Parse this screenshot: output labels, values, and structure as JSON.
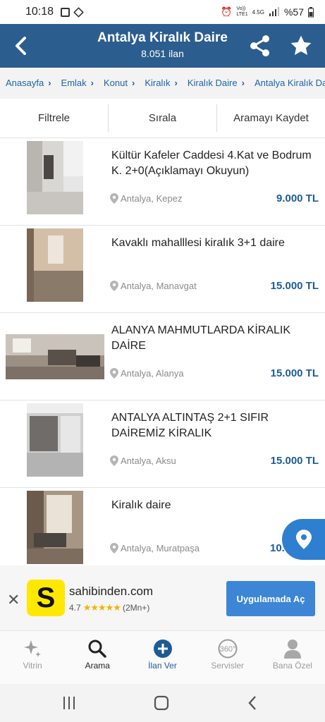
{
  "status": {
    "time": "10:18",
    "battery": "%57",
    "net_top": "Vo))",
    "net_bot": "LTE1",
    "gen": "4.5G"
  },
  "header": {
    "title": "Antalya Kiralık Daire",
    "subtitle": "8.051 ilan"
  },
  "breadcrumb": [
    "Anasayfa",
    "Emlak",
    "Konut",
    "Kiralık",
    "Kiralık Daire",
    "Antalya Kiralık Daire"
  ],
  "filters": {
    "filter": "Filtrele",
    "sort": "Sırala",
    "save": "Aramayı Kaydet"
  },
  "listings": [
    {
      "title": "Kültür Kafeler Caddesi 4.Kat ve Bodrum K. 2+0(Açıklamayı Okuyun)",
      "location": "Antalya, Kepez",
      "price": "9.000 TL"
    },
    {
      "title": "Kavaklı mahalllesi kiralık 3+1 daire",
      "location": "Antalya, Manavgat",
      "price": "15.000 TL"
    },
    {
      "title": "ALANYA MAHMUTLARDA KİRALIK DAİRE",
      "location": "Antalya, Alanya",
      "price": "15.000 TL"
    },
    {
      "title": "ANTALYA ALTINTAŞ 2+1 SIFIR DAİREMİZ KİRALIK",
      "location": "Antalya, Aksu",
      "price": "15.000 TL"
    },
    {
      "title": "Kiralık daire",
      "location": "Antalya, Muratpaşa",
      "price": "10."
    }
  ],
  "banner": {
    "logo_letter": "S",
    "app_name": "sahibinden.com",
    "rating": "4.7",
    "stars": "★★★★★",
    "downloads": "(2Mn+)",
    "open_button": "Uygulamada Aç"
  },
  "nav": {
    "vitrin": "Vitrin",
    "arama": "Arama",
    "ilan_ver": "İlan Ver",
    "servisler": "Servisler",
    "bana_ozel": "Bana Özel",
    "badge_360": "360°"
  },
  "colors": {
    "header": "#2b5d8f",
    "price": "#1d5b96",
    "accent_button": "#3d86d6",
    "logo_yellow": "#ffe800"
  }
}
